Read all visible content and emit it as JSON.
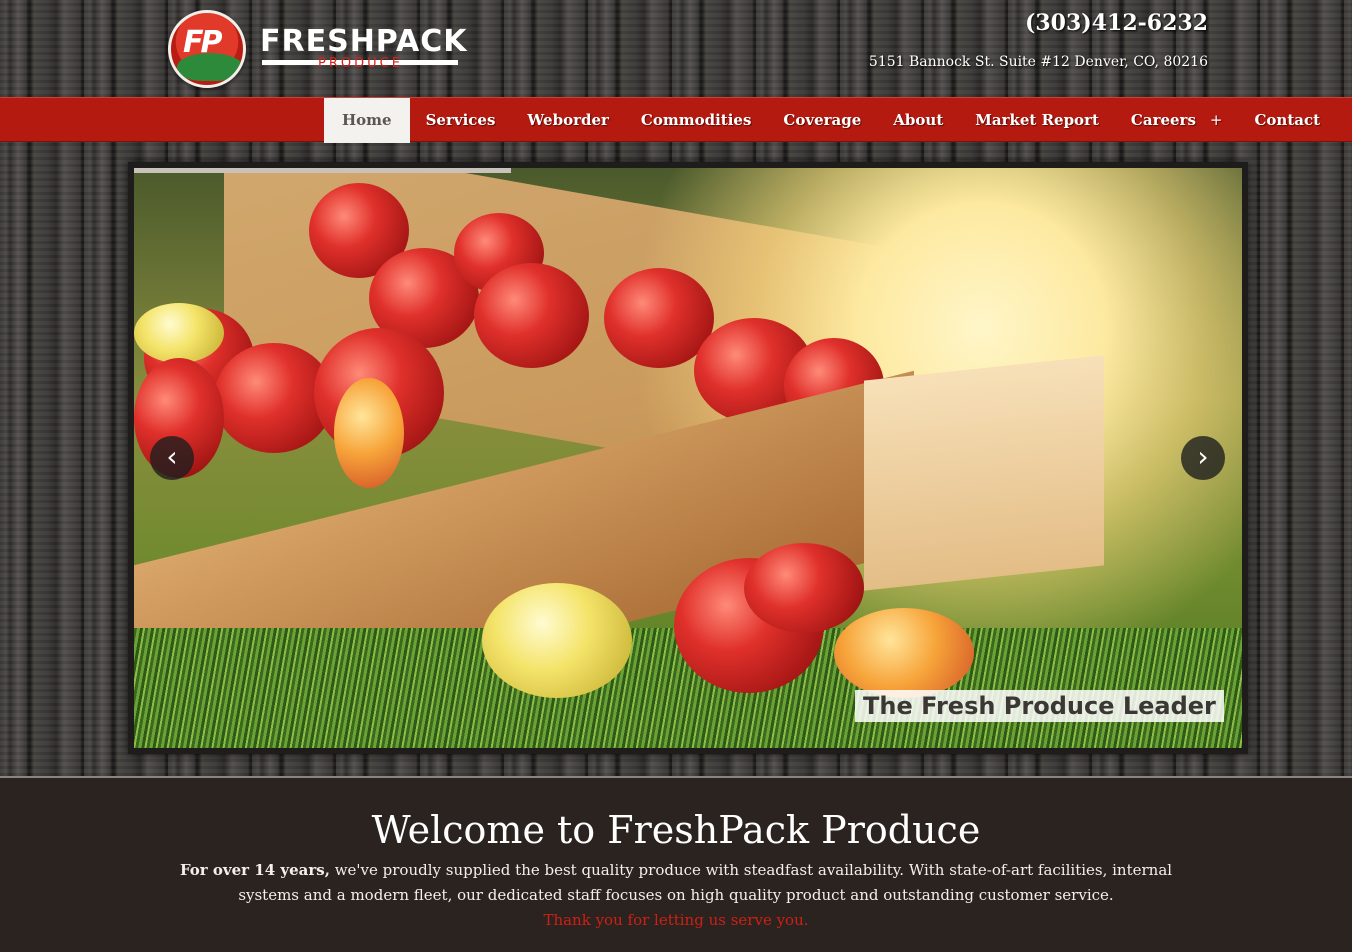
{
  "header": {
    "logo_text": "FRESHPACK",
    "logo_subtext": "PRODUCE",
    "logo_badge_text": "FP",
    "phone": "(303)412-6232",
    "address": "5151 Bannock St. Suite #12 Denver, CO, 80216"
  },
  "nav": {
    "items": [
      {
        "label": "Home",
        "active": true
      },
      {
        "label": "Services"
      },
      {
        "label": "Weborder"
      },
      {
        "label": "Commodities"
      },
      {
        "label": "Coverage"
      },
      {
        "label": "About"
      },
      {
        "label": "Market Report"
      },
      {
        "label": "Careers",
        "has_submenu": true
      },
      {
        "label": "Contact"
      }
    ],
    "submenu_symbol": "+"
  },
  "slider": {
    "caption": "The Fresh Produce Leader",
    "prev_symbol": "‹",
    "next_symbol": "›",
    "progress": 0.34,
    "image": "apples-in-wooden-crate-on-grass"
  },
  "welcome": {
    "title": "Welcome to FreshPack Produce",
    "intro_bold": "For over 14 years,",
    "intro_text": " we've proudly supplied the best quality produce with steadfast availability. With state-of-art facilities, internal systems and a modern fleet, our dedicated staff focuses on high quality product and outstanding customer service.",
    "thanks": "Thank you for letting us serve you."
  },
  "colors": {
    "nav_red": "#b51a10",
    "accent_red": "#d01f14",
    "footer_bg": "#2b2320"
  }
}
